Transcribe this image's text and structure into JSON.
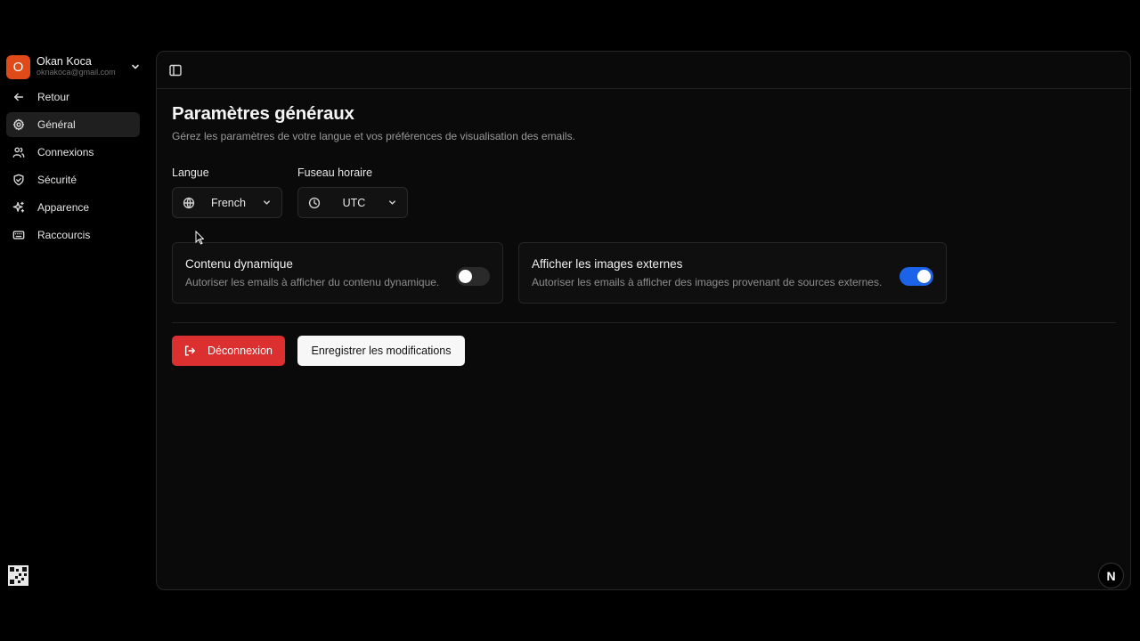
{
  "account": {
    "initial": "O",
    "name": "Okan Koca",
    "email": "oknakoca@gmail.com",
    "avatar_color": "#e04a18"
  },
  "sidebar": {
    "items": [
      {
        "label": "Retour",
        "icon": "arrow-left-icon",
        "active": false
      },
      {
        "label": "Général",
        "icon": "gear-icon",
        "active": true
      },
      {
        "label": "Connexions",
        "icon": "users-icon",
        "active": false
      },
      {
        "label": "Sécurité",
        "icon": "shield-icon",
        "active": false
      },
      {
        "label": "Apparence",
        "icon": "sparkles-icon",
        "active": false
      },
      {
        "label": "Raccourcis",
        "icon": "keyboard-icon",
        "active": false
      }
    ]
  },
  "main": {
    "title": "Paramètres généraux",
    "subtitle": "Gérez les paramètres de votre langue et vos préférences de visualisation des emails.",
    "language": {
      "label": "Langue",
      "value": "French",
      "icon": "globe-icon"
    },
    "timezone": {
      "label": "Fuseau horaire",
      "value": "UTC",
      "icon": "clock-icon"
    },
    "dynamic_content": {
      "title": "Contenu dynamique",
      "description": "Autoriser les emails à afficher du contenu dynamique.",
      "enabled": false
    },
    "external_images": {
      "title": "Afficher les images externes",
      "description": "Autoriser les emails à afficher des images provenant de sources externes.",
      "enabled": true
    },
    "logout_label": "Déconnexion",
    "save_label": "Enregistrer les modifications"
  },
  "colors": {
    "accent": "#1b63e8",
    "danger": "#dc2f2f"
  },
  "badge": {
    "letter": "N"
  }
}
